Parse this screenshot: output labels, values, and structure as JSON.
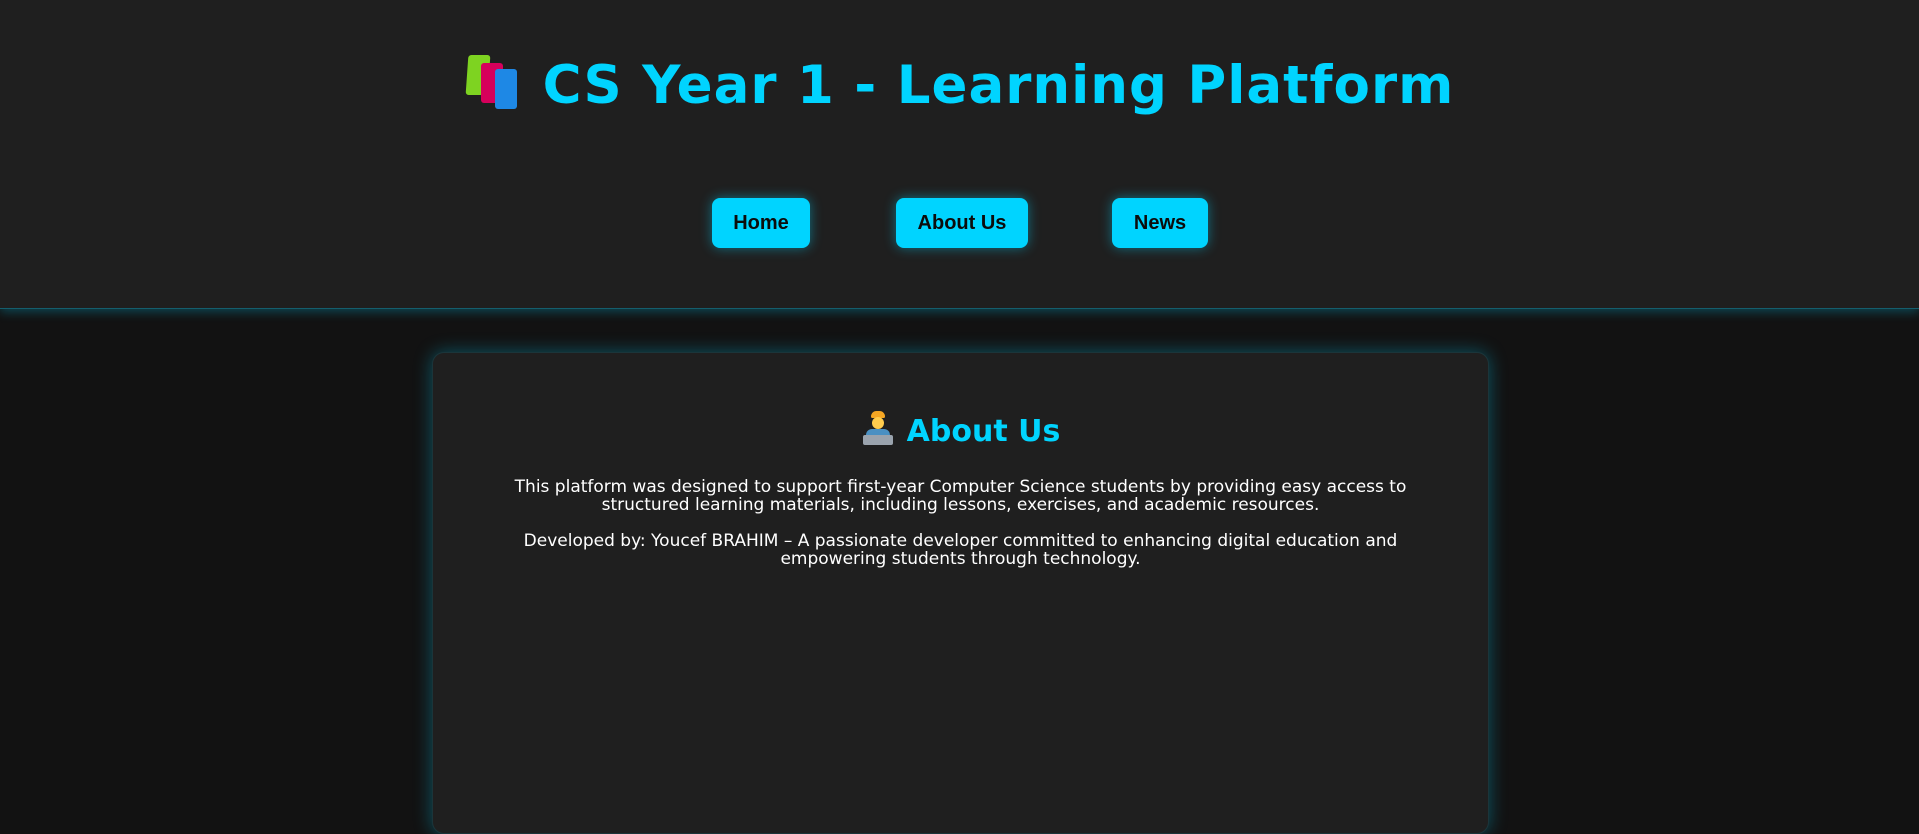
{
  "header": {
    "title": "CS Year 1 - Learning Platform",
    "title_icon": "books-icon"
  },
  "nav": {
    "items": [
      {
        "label": "Home"
      },
      {
        "label": "About Us"
      },
      {
        "label": "News"
      }
    ]
  },
  "about": {
    "heading": "About Us",
    "heading_icon": "technologist-icon",
    "paragraph_1": "This platform was designed to support first-year Computer Science students by providing easy access to structured learning materials, including lessons, exercises, and academic resources.",
    "paragraph_2": "Developed by: Youcef BRAHIM – A passionate developer committed to enhancing digital education and empowering students through technology."
  },
  "colors": {
    "accent": "#00d4ff",
    "header_bg": "#1f1f1f",
    "page_bg": "#121212",
    "card_bg": "#1f1f1f",
    "button_text": "#0c0c0c",
    "body_text": "#ffffff"
  }
}
